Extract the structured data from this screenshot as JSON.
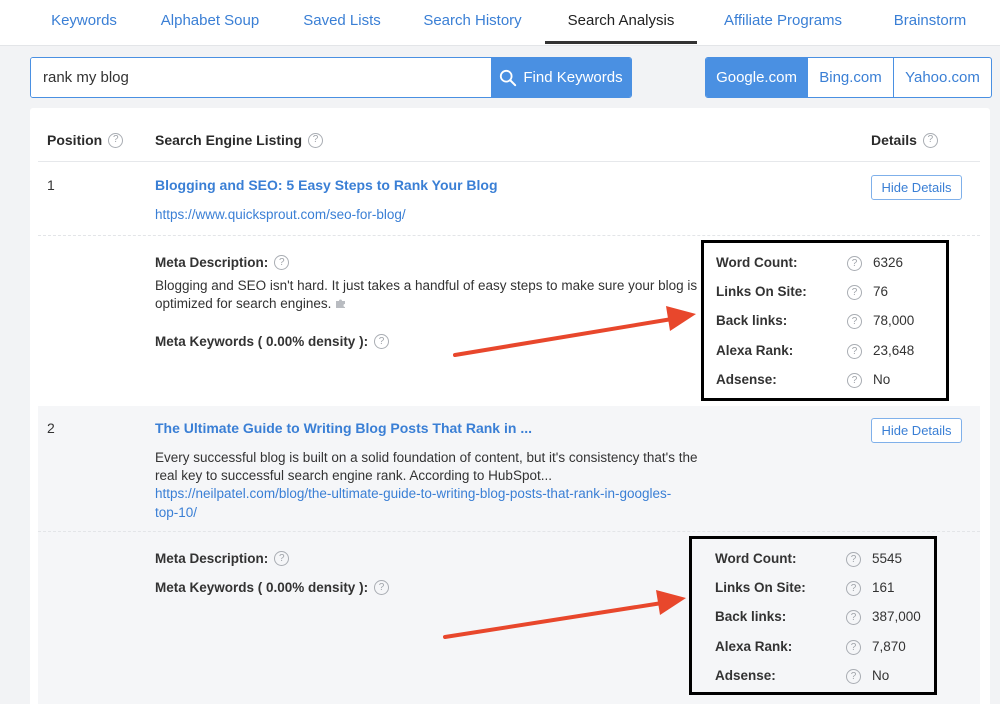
{
  "tabs": [
    {
      "label": "Keywords"
    },
    {
      "label": "Alphabet Soup"
    },
    {
      "label": "Saved Lists"
    },
    {
      "label": "Search History"
    },
    {
      "label": "Search Analysis"
    },
    {
      "label": "Affiliate Programs"
    },
    {
      "label": "Brainstorm"
    }
  ],
  "search": {
    "value": "rank my blog",
    "button_label": "Find Keywords"
  },
  "engines": [
    "Google.com",
    "Bing.com",
    "Yahoo.com"
  ],
  "table": {
    "col_position": "Position",
    "col_listing": "Search Engine Listing",
    "col_details": "Details"
  },
  "results": [
    {
      "position": "1",
      "title": "Blogging and SEO: 5 Easy Steps to Rank Your Blog",
      "url": "https://www.quicksprout.com/seo-for-blog/",
      "hide_label": "Hide Details",
      "meta_description_label": "Meta Description:",
      "meta_description_line1": "Blogging and SEO isn't hard. It just takes a handful of easy steps to make sure your blog is",
      "meta_description_line2": "optimized for search engines.",
      "meta_keywords_label": "Meta Keywords ( 0.00% density ):",
      "details": [
        {
          "label": "Word Count:",
          "value": "6326"
        },
        {
          "label": "Links On Site:",
          "value": "76"
        },
        {
          "label": "Back links:",
          "value": "78,000"
        },
        {
          "label": "Alexa Rank:",
          "value": "23,648"
        },
        {
          "label": "Adsense:",
          "value": "No"
        }
      ]
    },
    {
      "position": "2",
      "title": "The Ultimate Guide to Writing Blog Posts That Rank in ...",
      "snippet_line1": "Every successful blog is built on a solid foundation of content, but it's consistency that's the",
      "snippet_line2": "real key to successful search engine rank. According to HubSpot...",
      "url_line1": "https://neilpatel.com/blog/the-ultimate-guide-to-writing-blog-posts-that-rank-in-googles-",
      "url_line2": "top-10/",
      "hide_label": "Hide Details",
      "meta_description_label": "Meta Description:",
      "meta_keywords_label": "Meta Keywords ( 0.00% density ):",
      "details": [
        {
          "label": "Word Count:",
          "value": "5545"
        },
        {
          "label": "Links On Site:",
          "value": "161"
        },
        {
          "label": "Back links:",
          "value": "387,000"
        },
        {
          "label": "Alexa Rank:",
          "value": "7,870"
        },
        {
          "label": "Adsense:",
          "value": "No"
        }
      ]
    }
  ],
  "colors": {
    "accent": "#4a90e2",
    "link": "#3a7fd5",
    "arrow": "#e8472c",
    "box": "#000000"
  },
  "icons": [
    "search-icon",
    "help-icon",
    "puzzle-icon"
  ]
}
